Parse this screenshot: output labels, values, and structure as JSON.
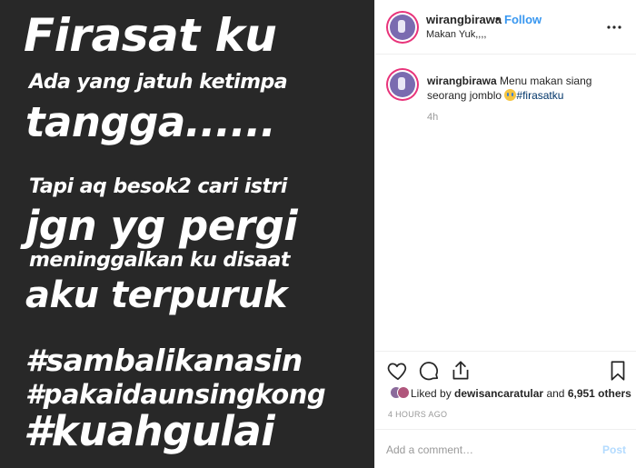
{
  "image": {
    "lines": [
      "Firasat ku",
      "Ada yang jatuh ketimpa",
      "tangga......",
      "Tapi aq besok2 cari istri",
      "jgn yg pergi",
      "meninggalkan ku disaat",
      "aku terpuruk",
      "#sambalikanasin",
      "#pakaidaunsingkong",
      "#kuahgulai"
    ],
    "background_color": "#282828",
    "text_color": "#ffffff"
  },
  "header": {
    "username": "wirangbirawa",
    "separator": "•",
    "follow_label": "Follow",
    "location": "Makan Yuk,,,,",
    "more_icon": "more-horizontal-icon"
  },
  "caption": {
    "username": "wirangbirawa",
    "text": "Menu makan siang seorang jomblo",
    "emoji": "crying-face-emoji",
    "hashtag": "#firasatku",
    "time_ago": "4h"
  },
  "actions": {
    "icons": [
      "heart-icon",
      "comment-bubble-icon",
      "share-icon",
      "bookmark-icon"
    ]
  },
  "likes": {
    "prefix": "Liked by",
    "user": "dewisancaratular",
    "conjunction": "and",
    "others": "6,951 others"
  },
  "post_time": "4 HOURS AGO",
  "comment_box": {
    "placeholder": "Add a comment…",
    "post_label": "Post"
  },
  "colors": {
    "link_blue": "#3897f0",
    "hashtag_blue": "#003569",
    "post_disabled": "#b3dbff",
    "avatar_ring": "#e8337a"
  }
}
